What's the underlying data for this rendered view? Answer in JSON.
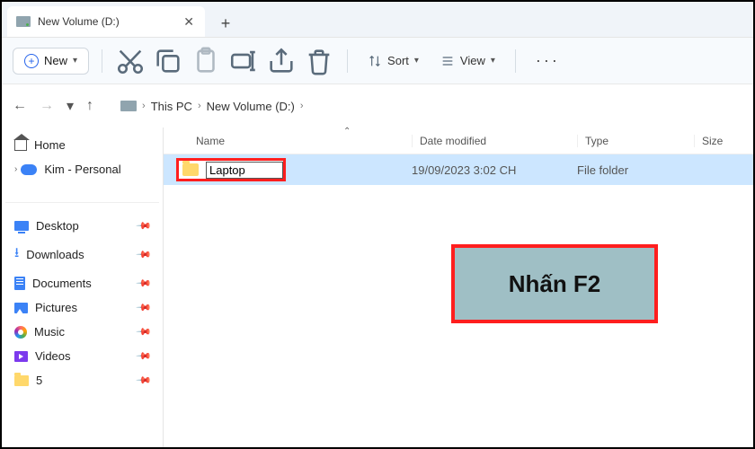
{
  "tab": {
    "title": "New Volume (D:)"
  },
  "toolbar": {
    "new_label": "New",
    "sort_label": "Sort",
    "view_label": "View"
  },
  "breadcrumb": {
    "segments": [
      "This PC",
      "New Volume (D:)"
    ]
  },
  "sidebar": {
    "top": [
      {
        "label": "Home"
      },
      {
        "label": "Kim - Personal"
      }
    ],
    "pinned": [
      {
        "label": "Desktop"
      },
      {
        "label": "Downloads"
      },
      {
        "label": "Documents"
      },
      {
        "label": "Pictures"
      },
      {
        "label": "Music"
      },
      {
        "label": "Videos"
      },
      {
        "label": "5"
      }
    ]
  },
  "columns": {
    "name": "Name",
    "date": "Date modified",
    "type": "Type",
    "size": "Size"
  },
  "rows": [
    {
      "name_editing": "Laptop",
      "date": "19/09/2023 3:02 CH",
      "type": "File folder"
    }
  ],
  "callout": {
    "text": "Nhấn F2"
  }
}
